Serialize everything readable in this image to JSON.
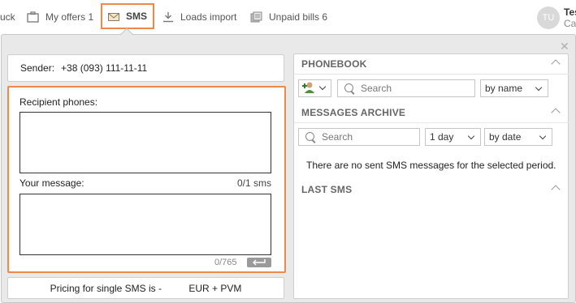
{
  "nav": {
    "truck_label": "uck",
    "offers_label": "My offers 1",
    "sms_label": "SMS",
    "loads_label": "Loads import",
    "bills_label": "Unpaid bills 6",
    "avatar_initials": "TU",
    "user_name": "Tes",
    "user_sub": "Ca"
  },
  "sms": {
    "sender_label": "Sender:",
    "sender_value": "+38 (093) 111-11-11",
    "recipient_label": "Recipient phones:",
    "recipient_value": "",
    "message_label": "Your message:",
    "sms_count": "0/1 sms",
    "message_value": "",
    "char_count": "0/765",
    "pricing_text": "Pricing for single SMS is -          EUR + PVM"
  },
  "phonebook": {
    "title": "PHONEBOOK",
    "search_placeholder": "Search",
    "sort_value": "by name"
  },
  "archive": {
    "title": "MESSAGES ARCHIVE",
    "search_placeholder": "Search",
    "period_value": "1 day",
    "sort_value": "by date",
    "empty_text": "There are no sent SMS messages for the selected period."
  },
  "last_sms": {
    "title": "LAST SMS"
  },
  "colors": {
    "accent": "#f0884a",
    "panel_bg": "#e9e9e9"
  },
  "icons": [
    "truck-icon",
    "briefcase-icon",
    "envelope-icon",
    "download-icon",
    "bills-icon",
    "close-icon",
    "add-contact-icon",
    "search-icon",
    "chevron-up-icon",
    "chevron-down-icon",
    "enter-icon"
  ]
}
